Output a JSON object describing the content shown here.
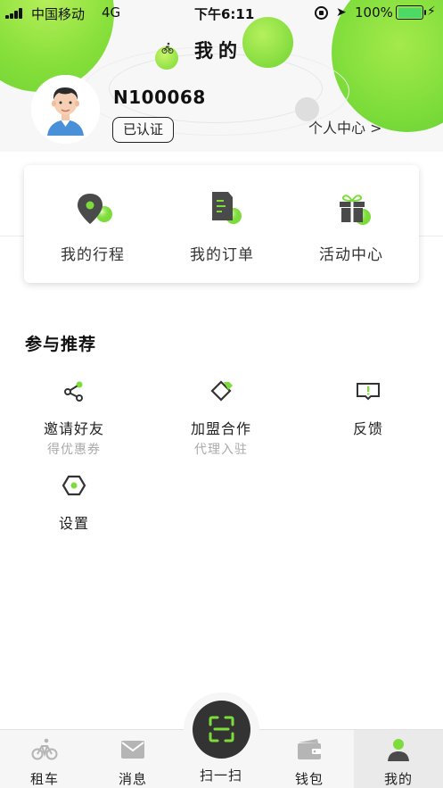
{
  "status_bar": {
    "carrier": "中国移动",
    "network": "4G",
    "time": "下午6:11",
    "battery": "100%"
  },
  "header": {
    "title": "我的",
    "user_id": "N100068",
    "verified_badge": "已认证",
    "profile_link": "个人中心  >"
  },
  "quick_actions": [
    {
      "label": "我的行程",
      "icon": "location-pin-icon"
    },
    {
      "label": "我的订单",
      "icon": "document-icon"
    },
    {
      "label": "活动中心",
      "icon": "gift-icon"
    }
  ],
  "recommend": {
    "title": "参与推荐",
    "items": [
      {
        "label": "邀请好友",
        "sub": "得优惠券",
        "icon": "share-icon"
      },
      {
        "label": "加盟合作",
        "sub": "代理入驻",
        "icon": "diamond-tag-icon"
      },
      {
        "label": "反馈",
        "sub": "",
        "icon": "feedback-icon"
      },
      {
        "label": "设置",
        "sub": "",
        "icon": "hexagon-settings-icon"
      }
    ]
  },
  "tabbar": {
    "tabs": [
      {
        "label": "租车",
        "icon": "bicycle-icon"
      },
      {
        "label": "消息",
        "icon": "message-icon"
      },
      {
        "label": "扫一扫",
        "icon": "scan-icon"
      },
      {
        "label": "钱包",
        "icon": "wallet-icon"
      },
      {
        "label": "我的",
        "icon": "person-icon"
      }
    ],
    "active": "我的"
  },
  "colors": {
    "accent_green": "#7cdc3a",
    "dark_icon": "#4a4a4a"
  }
}
